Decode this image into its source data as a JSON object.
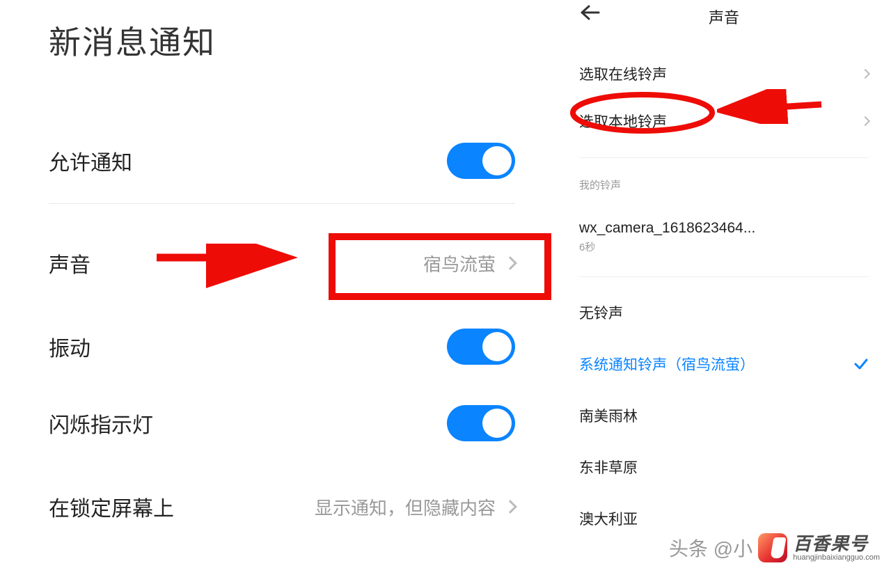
{
  "left": {
    "title": "新消息通知",
    "rows": {
      "allow": {
        "label": "允许通知"
      },
      "sound": {
        "label": "声音",
        "value": "宿鸟流萤"
      },
      "vibrate": {
        "label": "振动"
      },
      "led": {
        "label": "闪烁指示灯"
      },
      "lockscreen": {
        "label": "在锁定屏幕上",
        "value": "显示通知，但隐藏内容"
      }
    }
  },
  "right": {
    "title": "声音",
    "online": "选取在线铃声",
    "local": "选取本地铃声",
    "section_my": "我的铃声",
    "my_item": {
      "name": "wx_camera_1618623464...",
      "duration": "6秒"
    },
    "none": "无铃声",
    "system": "系统通知铃声（宿鸟流萤）",
    "opt1": "南美雨林",
    "opt2": "东非草原",
    "opt3": "澳大利亚"
  },
  "watermark": {
    "head": "头条 @小",
    "cn": "百香果号",
    "url": "huangjinbaixiangguo.com"
  },
  "colors": {
    "accent": "#0a84ff",
    "highlight": "#ee0c06"
  }
}
